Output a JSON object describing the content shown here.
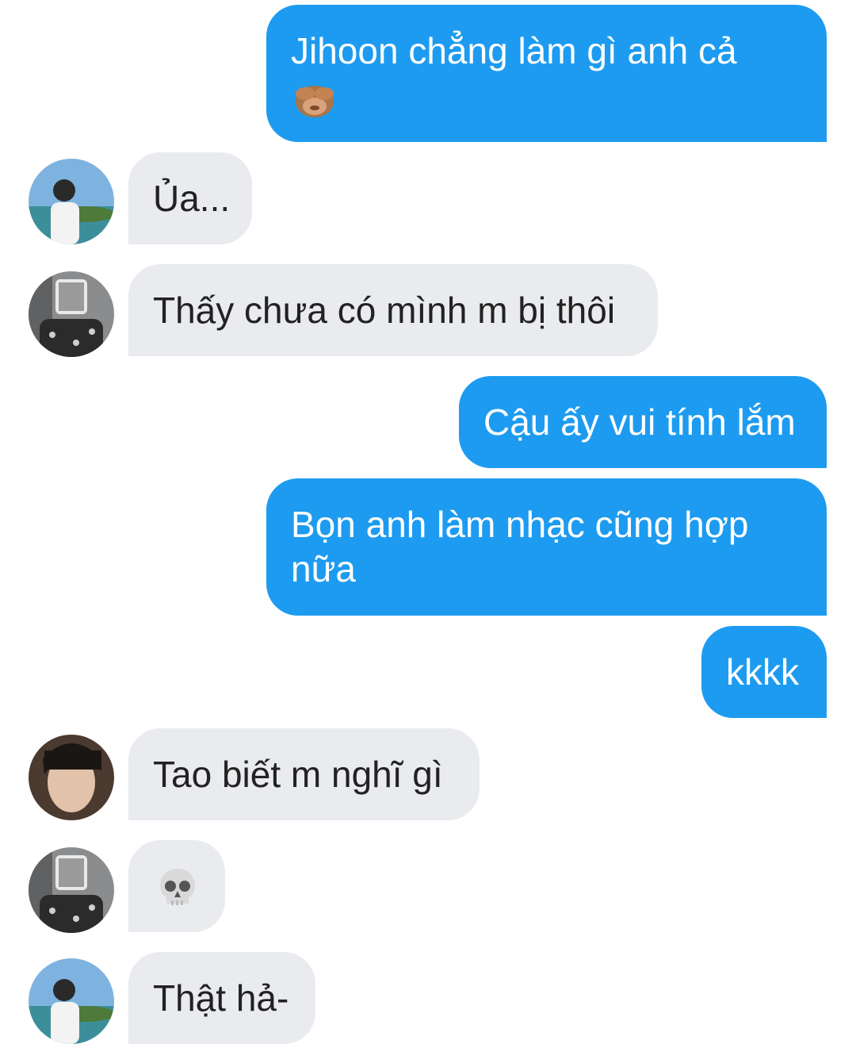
{
  "messages": [
    {
      "id": "m1",
      "direction": "outgoing",
      "text": "Jihoon chẳng làm gì anh cả",
      "emoji": "see-no-evil-monkey"
    },
    {
      "id": "m2",
      "direction": "incoming",
      "text": "Ủa..."
    },
    {
      "id": "m3",
      "direction": "incoming",
      "text": "Thấy chưa có mình m bị thôi"
    },
    {
      "id": "m4",
      "direction": "outgoing",
      "text": "Cậu ấy vui tính lắm"
    },
    {
      "id": "m5",
      "direction": "outgoing",
      "text": "Bọn anh làm nhạc cũng hợp nữa"
    },
    {
      "id": "m6",
      "direction": "outgoing",
      "text": "kkkk"
    },
    {
      "id": "m7",
      "direction": "incoming",
      "text": "Tao biết m nghĩ gì"
    },
    {
      "id": "m8",
      "direction": "incoming",
      "emoji": "skull"
    },
    {
      "id": "m9",
      "direction": "incoming",
      "text": "Thật hả-"
    }
  ],
  "colors": {
    "outgoing_bubble": "#1d9bf0",
    "incoming_bubble": "#e9ebee",
    "outgoing_text": "#ffffff",
    "incoming_text": "#222222"
  }
}
